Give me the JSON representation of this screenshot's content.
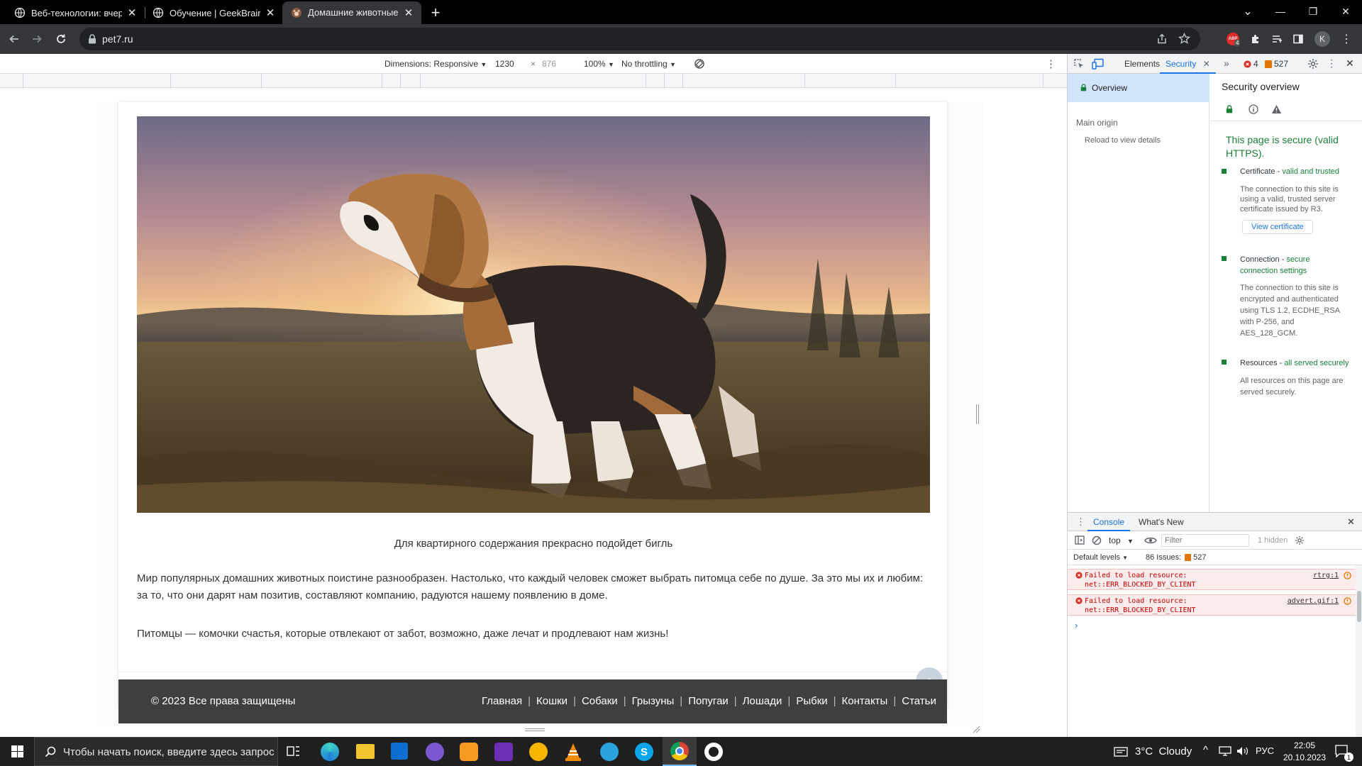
{
  "tabs": [
    {
      "title": "Веб-технологии: вчера, сегодня",
      "close": "✕"
    },
    {
      "title": "Обучение | GeekBrains - образо",
      "close": "✕"
    },
    {
      "title": "Домашние животные 🐱 Все п",
      "close": "✕",
      "active": true
    }
  ],
  "new_tab": "+",
  "window": {
    "min": "—",
    "max": "❐",
    "close": "✕",
    "dropdown": "⌄"
  },
  "url": "pet7.ru",
  "toolbar": {
    "profile": "K",
    "ext_badge": "ABP",
    "ext_count": "4"
  },
  "device": {
    "dimensions_label": "Dimensions: Responsive",
    "width": "1230",
    "height": "876",
    "zoom": "100%",
    "throttling": "No throttling"
  },
  "article": {
    "caption": "Для квартирного содержания прекрасно подойдет бигль",
    "paragraph1": "Мир популярных домашних животных поистине разнообразен. Настолько, что каждый человек сможет выбрать питомца себе по душе. За это мы их и любим: за то, что они дарят нам позитив, составляют компанию, радуются нашему появлению в доме.",
    "paragraph2": "Питомцы — комочки счастья, которые отвлекают от забот, возможно, даже лечат и продлевают нам жизнь!"
  },
  "footer": {
    "copyright": "© 2023 Все права защищены",
    "links": [
      "Главная",
      "Кошки",
      "Собаки",
      "Грызуны",
      "Попугаи",
      "Лошади",
      "Рыбки",
      "Контакты",
      "Статьи"
    ]
  },
  "devtools": {
    "tabs": [
      "Elements",
      "Security"
    ],
    "active_tab": "Security",
    "more": "»",
    "errors": "4",
    "warnings": "527",
    "sidebar": {
      "overview": "Overview",
      "main_origin": "Main origin",
      "reload": "Reload to view details"
    },
    "security": {
      "heading": "Security overview",
      "secure_text": "This page is secure (valid HTTPS).",
      "items": [
        {
          "label": "Certificate",
          "status": "valid and trusted",
          "desc": "The connection to this site is using a valid, trusted server certificate issued by R3.",
          "button": "View certificate"
        },
        {
          "label": "Connection",
          "status": "secure connection settings",
          "desc": "The connection to this site is encrypted and authenticated using TLS 1.2, ECDHE_RSA with P-256, and AES_128_GCM."
        },
        {
          "label": "Resources",
          "status": "all served securely",
          "desc": "All resources on this page are served securely."
        }
      ]
    },
    "drawer": {
      "tabs": [
        "Console",
        "What's New"
      ],
      "active_tab": "Console",
      "context": "top",
      "filter_placeholder": "Filter",
      "hidden": "1 hidden",
      "levels": "Default levels",
      "issues_label": "86 Issues:",
      "issues_count": "527",
      "messages": [
        {
          "text1": "Failed to load resource:",
          "text2": "net::ERR_BLOCKED_BY_CLIENT",
          "source": "rtrg:1"
        },
        {
          "text1": "Failed to load resource:",
          "text2": "net::ERR_BLOCKED_BY_CLIENT",
          "source": "advert.gif:1"
        }
      ],
      "prompt": "›"
    }
  },
  "taskbar": {
    "search_placeholder": "Чтобы начать поиск, введите здесь запрос",
    "weather": "3°C  Cloudy",
    "lang": "РУС",
    "time": "22:05",
    "date": "20.10.2023",
    "notif_count": "1"
  },
  "colors": {
    "secure_green": "#188038",
    "devtools_blue": "#1a73e8",
    "footer_bg": "#3f3f3f",
    "error_bg": "#fcebeb",
    "error_text": "#c80000"
  }
}
